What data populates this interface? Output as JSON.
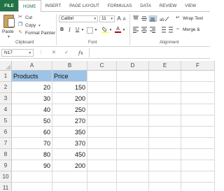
{
  "ribbon_tabs": [
    "FILE",
    "HOME",
    "INSERT",
    "PAGE LAYOUT",
    "FORMULAS",
    "DATA",
    "REVIEW",
    "VIEW"
  ],
  "clipboard": {
    "paste_label": "Paste",
    "cut_label": "Cut",
    "copy_label": "Copy",
    "format_painter_label": "Format Painter",
    "group_label": "Clipboard"
  },
  "font": {
    "family": "Calibri",
    "size": "11",
    "bold": "B",
    "italic": "I",
    "underline": "U",
    "grow": "A",
    "shrink": "A",
    "font_color_letter": "A",
    "group_label": "Font"
  },
  "alignment": {
    "wrap_text_label": "Wrap Text",
    "merge_label": "Merge &",
    "group_label": "Alignment"
  },
  "formula_bar": {
    "name_box": "N17",
    "fx": "fx",
    "cancel": "✕",
    "enter": "✓",
    "formula": ""
  },
  "sheet": {
    "columns": [
      "A",
      "B",
      "C",
      "D",
      "E",
      "F"
    ],
    "rows": [
      "1",
      "2",
      "3",
      "4",
      "5",
      "6",
      "7",
      "8",
      "9",
      "10",
      "11"
    ],
    "header_row": [
      "Products",
      "Price"
    ],
    "data": [
      [
        "20",
        "150"
      ],
      [
        "30",
        "200"
      ],
      [
        "40",
        "250"
      ],
      [
        "50",
        "270"
      ],
      [
        "60",
        "350"
      ],
      [
        "70",
        "370"
      ],
      [
        "80",
        "450"
      ],
      [
        "90",
        "200"
      ]
    ]
  },
  "colors": {
    "accent": "#217346",
    "header_highlight": "#9dc3e6",
    "font_color_bar": "#c00000",
    "fill_color_bar": "#ffff00"
  }
}
